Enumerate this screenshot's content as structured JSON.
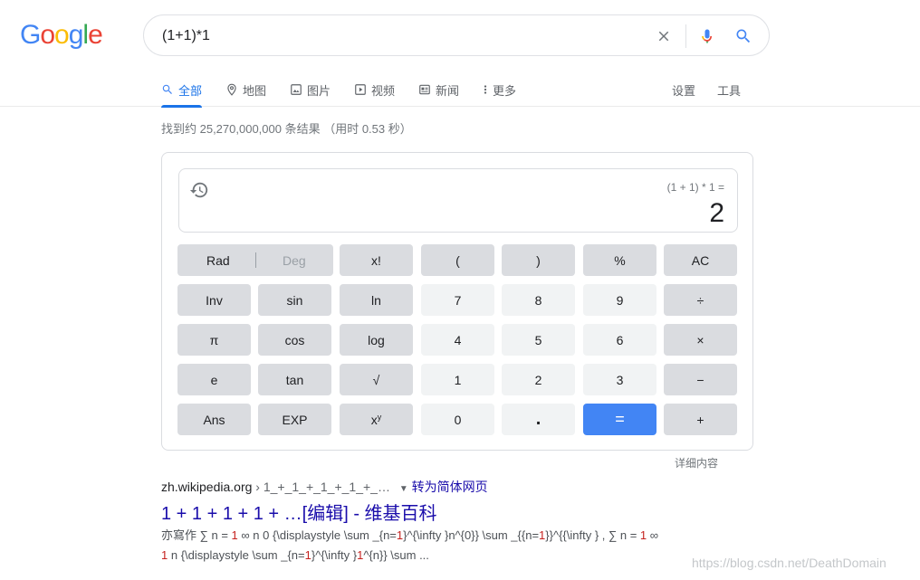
{
  "logo": {
    "letters": [
      "G",
      "o",
      "o",
      "g",
      "l",
      "e"
    ],
    "colors": [
      "#4285f4",
      "#ea4335",
      "#fbbc05",
      "#4285f4",
      "#34a853",
      "#ea4335"
    ]
  },
  "search": {
    "query": "(1+1)*1"
  },
  "tabs": [
    {
      "label": "全部",
      "icon": "search-icon",
      "active": true
    },
    {
      "label": "地图",
      "icon": "map-pin-icon"
    },
    {
      "label": "图片",
      "icon": "image-icon"
    },
    {
      "label": "视频",
      "icon": "video-icon"
    },
    {
      "label": "新闻",
      "icon": "news-icon"
    },
    {
      "label": "更多",
      "icon": "more-vert-icon"
    }
  ],
  "tools": {
    "settings": "设置",
    "tools": "工具"
  },
  "result_stats": "找到约 25,270,000,000 条结果 （用时 0.53 秒）",
  "calculator": {
    "expression": "(1 + 1) * 1 =",
    "result": "2",
    "buttons": {
      "rad": "Rad",
      "deg": "Deg",
      "fact": "x!",
      "lparen": "(",
      "rparen": ")",
      "percent": "%",
      "ac": "AC",
      "inv": "Inv",
      "sin": "sin",
      "ln": "ln",
      "n7": "7",
      "n8": "8",
      "n9": "9",
      "divide": "÷",
      "pi": "π",
      "cos": "cos",
      "log": "log",
      "n4": "4",
      "n5": "5",
      "n6": "6",
      "multiply": "×",
      "e": "e",
      "tan": "tan",
      "sqrt": "√",
      "n1": "1",
      "n2": "2",
      "n3": "3",
      "minus": "−",
      "ans": "Ans",
      "exp": "EXP",
      "pow_base": "x",
      "pow_exp": "y",
      "n0": "0",
      "dot": ".",
      "equals": "=",
      "plus": "+"
    },
    "details_link": "详细内容"
  },
  "result": {
    "domain": "zh.wikipedia.org",
    "path": " › 1_+_1_+_1_+_1_+_…",
    "translate": "转为简体网页",
    "title": "1 + 1 + 1 + 1 + …[编辑] - 维基百科",
    "snippet_line1": [
      "亦寫作 ∑ n = ",
      "1",
      " ∞ n 0 {\\displaystyle \\sum _{n=",
      "1",
      "}^{\\infty }n^{0}} \\sum _{{n=",
      "1",
      "}}^{{\\infty } , ∑ n = ",
      "1",
      " ∞"
    ],
    "snippet_line2": [
      "1",
      " n {\\displaystyle \\sum _{n=",
      "1",
      "}^{\\infty }",
      "1",
      "^{n}} \\sum ..."
    ]
  },
  "watermark": "https://blog.csdn.net/DeathDomain",
  "colors": {
    "accent": "#1a73e8",
    "equals_button": "#4285f4",
    "link": "#1a0dab"
  }
}
